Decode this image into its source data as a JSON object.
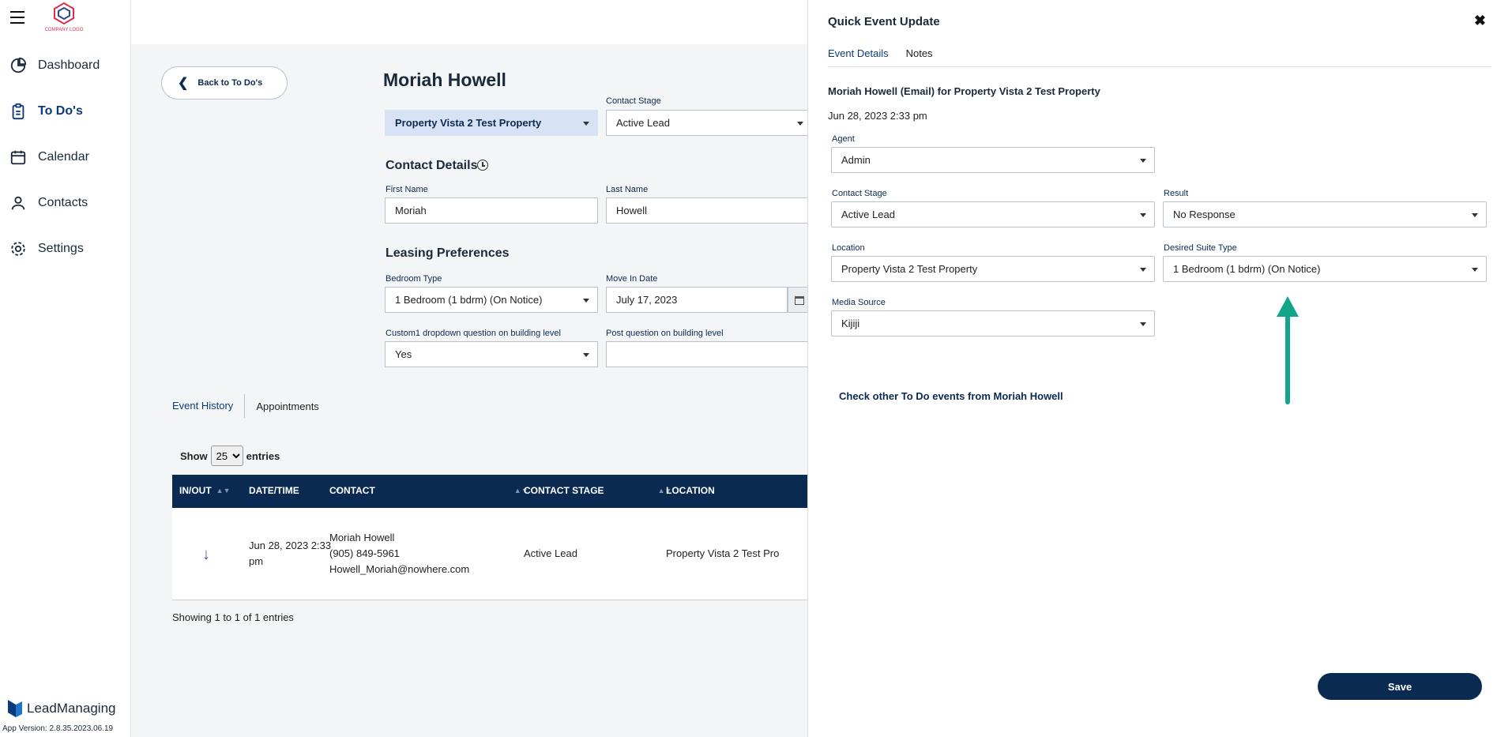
{
  "sidebar": {
    "logo_text": "COMPANY LOGO",
    "items": [
      {
        "label": "Dashboard",
        "icon": "pie-chart-icon"
      },
      {
        "label": "To Do's",
        "icon": "clipboard-icon",
        "active": true
      },
      {
        "label": "Calendar",
        "icon": "calendar-icon"
      },
      {
        "label": "Contacts",
        "icon": "users-icon"
      },
      {
        "label": "Settings",
        "icon": "gear-icon"
      }
    ],
    "brand": "LeadManaging",
    "version": "App Version: 2.8.35.2023.06.19"
  },
  "main": {
    "back_label": "Back to To Do's",
    "contact_name": "Moriah Howell",
    "property_select": "Property Vista 2 Test Property",
    "contact_stage_label": "Contact Stage",
    "contact_stage_value": "Active Lead",
    "contact_details_title": "Contact Details",
    "first_name_label": "First Name",
    "first_name_value": "Moriah",
    "last_name_label": "Last Name",
    "last_name_value": "Howell",
    "leasing_title": "Leasing Preferences",
    "bedroom_label": "Bedroom Type",
    "bedroom_value": "1 Bedroom (1 bdrm) (On Notice)",
    "move_in_label": "Move In Date",
    "move_in_value": "July 17, 2023",
    "custom1_label": "Custom1 dropdown question on building level",
    "custom1_value": "Yes",
    "post_q_label": "Post question on building level",
    "post_q_value": "",
    "tabs": [
      "Event History",
      "Appointments"
    ],
    "show_label": "Show",
    "show_value": "25",
    "entries_label": "entries",
    "table": {
      "headers": [
        "IN/OUT",
        "DATE/TIME",
        "CONTACT",
        "CONTACT STAGE",
        "LOCATION"
      ],
      "rows": [
        {
          "date_line1": "Jun 28, 2023 2:33",
          "date_line2": "pm",
          "contact_name": "Moriah Howell",
          "contact_phone": "(905) 849-5961",
          "contact_email": "Howell_Moriah@nowhere.com",
          "stage": "Active Lead",
          "location": "Property Vista 2 Test Pro"
        }
      ]
    },
    "showing_text": "Showing 1 to 1 of 1 entries"
  },
  "panel": {
    "title": "Quick Event Update",
    "tabs": [
      "Event Details",
      "Notes"
    ],
    "event_title": "Moriah Howell (Email) for Property Vista 2 Test Property",
    "event_date": "Jun 28, 2023 2:33 pm",
    "agent_label": "Agent",
    "agent_value": "Admin",
    "stage_label": "Contact Stage",
    "stage_value": "Active Lead",
    "result_label": "Result",
    "result_value": "No Response",
    "location_label": "Location",
    "location_value": "Property Vista 2 Test Property",
    "suite_label": "Desired Suite Type",
    "suite_value": "1 Bedroom (1 bdrm) (On Notice)",
    "media_label": "Media Source",
    "media_value": "Kijiji",
    "check_link": "Check other To Do events from Moriah Howell",
    "save_label": "Save"
  },
  "colors": {
    "primary": "#0b2a52",
    "accent_arrow": "#12a58b",
    "highlight_select": "#d7e3f4"
  }
}
